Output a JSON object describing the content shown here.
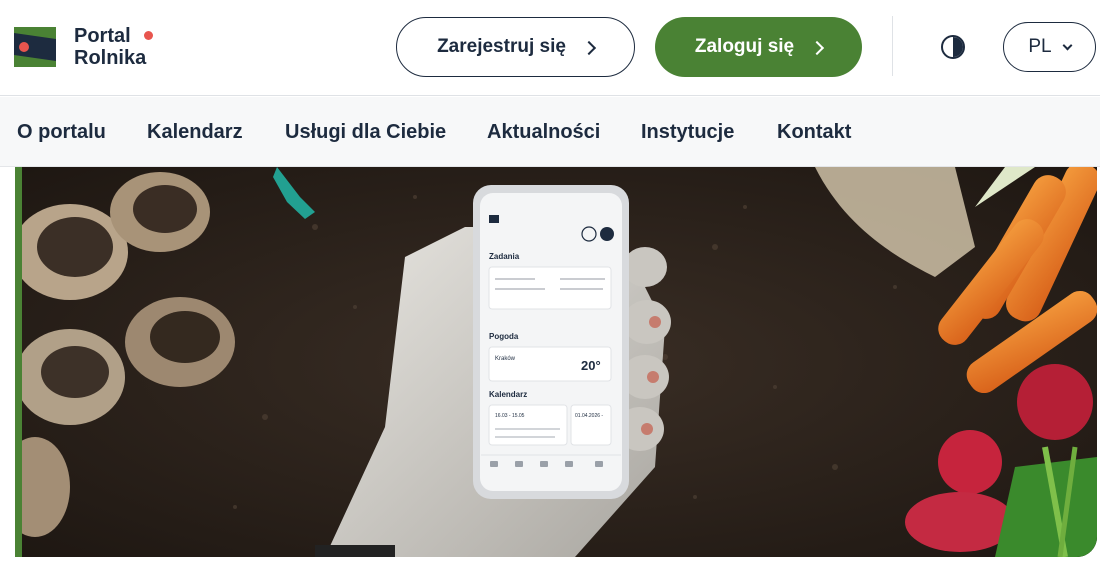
{
  "header": {
    "logo_line1": "Portal",
    "logo_line2": "Rolnika",
    "register_label": "Zarejestruj się",
    "login_label": "Zaloguj się",
    "language": "PL"
  },
  "nav": {
    "items": [
      "O portalu",
      "Kalendarz",
      "Usługi dla Ciebie",
      "Aktualności",
      "Instytucje",
      "Kontakt"
    ]
  },
  "hero": {
    "phone": {
      "section_tasks": "Zadania",
      "section_weather": "Pogoda",
      "weather_city": "Kraków",
      "weather_temp": "20°",
      "section_calendar": "Kalendarz",
      "calendar_time": "16.03 - 15.05",
      "calendar_date": "01.04.2026 -"
    }
  },
  "colors": {
    "brand_green": "#4a8234",
    "navy": "#1d2b3f",
    "accent_red": "#e8554e"
  },
  "icons": [
    "logo-mark-icon",
    "chevron-right-icon",
    "contrast-icon",
    "chevron-down-icon"
  ]
}
